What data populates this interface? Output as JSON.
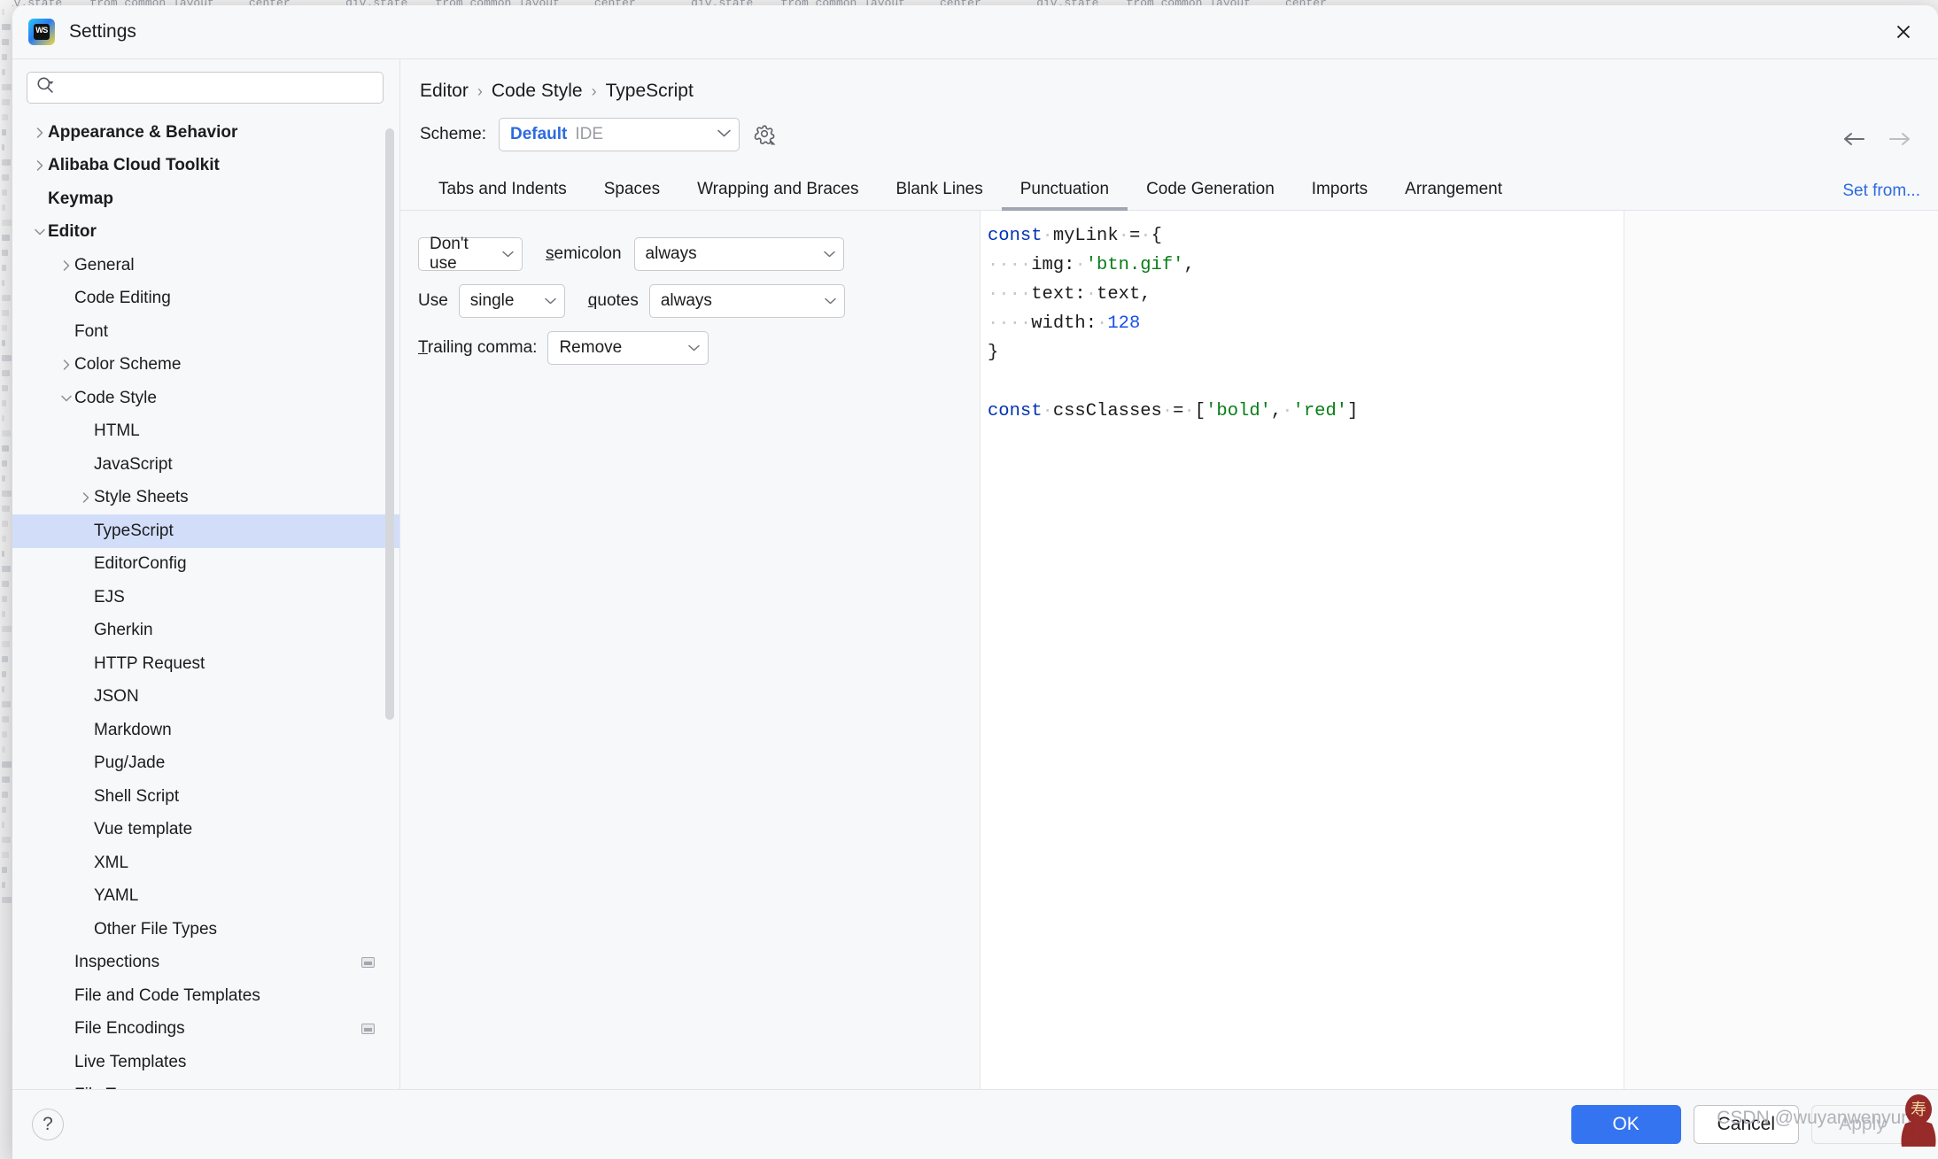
{
  "background": {
    "code_strip": "div.state    from common layout     center"
  },
  "window": {
    "title": "Settings",
    "app_icon": "webstorm-icon",
    "app_icon_text": "WS",
    "close_icon": "close-icon"
  },
  "sidebar": {
    "search": {
      "value": "",
      "placeholder": "",
      "icon": "search-icon"
    },
    "items": [
      {
        "label": "Appearance & Behavior",
        "depth": 0,
        "arrow": "right",
        "selected": false
      },
      {
        "label": "Alibaba Cloud Toolkit",
        "depth": 0,
        "arrow": "right",
        "selected": false
      },
      {
        "label": "Keymap",
        "depth": 0,
        "arrow": "none",
        "selected": false
      },
      {
        "label": "Editor",
        "depth": 0,
        "arrow": "down",
        "selected": false
      },
      {
        "label": "General",
        "depth": 1,
        "arrow": "right",
        "selected": false
      },
      {
        "label": "Code Editing",
        "depth": 1,
        "arrow": "none",
        "selected": false
      },
      {
        "label": "Font",
        "depth": 1,
        "arrow": "none",
        "selected": false
      },
      {
        "label": "Color Scheme",
        "depth": 1,
        "arrow": "right",
        "selected": false
      },
      {
        "label": "Code Style",
        "depth": 1,
        "arrow": "down",
        "selected": false
      },
      {
        "label": "HTML",
        "depth": 2,
        "arrow": "none",
        "selected": false
      },
      {
        "label": "JavaScript",
        "depth": 2,
        "arrow": "none",
        "selected": false
      },
      {
        "label": "Style Sheets",
        "depth": 2,
        "arrow": "right",
        "selected": false
      },
      {
        "label": "TypeScript",
        "depth": 2,
        "arrow": "none",
        "selected": true
      },
      {
        "label": "EditorConfig",
        "depth": 2,
        "arrow": "none",
        "selected": false
      },
      {
        "label": "EJS",
        "depth": 2,
        "arrow": "none",
        "selected": false
      },
      {
        "label": "Gherkin",
        "depth": 2,
        "arrow": "none",
        "selected": false
      },
      {
        "label": "HTTP Request",
        "depth": 2,
        "arrow": "none",
        "selected": false
      },
      {
        "label": "JSON",
        "depth": 2,
        "arrow": "none",
        "selected": false
      },
      {
        "label": "Markdown",
        "depth": 2,
        "arrow": "none",
        "selected": false
      },
      {
        "label": "Pug/Jade",
        "depth": 2,
        "arrow": "none",
        "selected": false
      },
      {
        "label": "Shell Script",
        "depth": 2,
        "arrow": "none",
        "selected": false
      },
      {
        "label": "Vue template",
        "depth": 2,
        "arrow": "none",
        "selected": false
      },
      {
        "label": "XML",
        "depth": 2,
        "arrow": "none",
        "selected": false
      },
      {
        "label": "YAML",
        "depth": 2,
        "arrow": "none",
        "selected": false
      },
      {
        "label": "Other File Types",
        "depth": 2,
        "arrow": "none",
        "selected": false
      },
      {
        "label": "Inspections",
        "depth": 1,
        "arrow": "none",
        "selected": false,
        "trailing_icon": "project-scope-icon"
      },
      {
        "label": "File and Code Templates",
        "depth": 1,
        "arrow": "none",
        "selected": false
      },
      {
        "label": "File Encodings",
        "depth": 1,
        "arrow": "none",
        "selected": false,
        "trailing_icon": "project-scope-icon"
      },
      {
        "label": "Live Templates",
        "depth": 1,
        "arrow": "none",
        "selected": false
      },
      {
        "label": "File Types",
        "depth": 1,
        "arrow": "none",
        "selected": false
      }
    ]
  },
  "main": {
    "breadcrumb": [
      "Editor",
      "Code Style",
      "TypeScript"
    ],
    "breadcrumb_separator": "›",
    "nav": {
      "back_icon": "arrow-left-icon",
      "forward_icon": "arrow-right-icon"
    },
    "set_from_link": "Set from...",
    "scheme": {
      "label": "Scheme:",
      "value": "Default",
      "value_suffix": "IDE",
      "gear_icon": "gear-icon",
      "chevron_icon": "chevron-down-icon"
    },
    "tabs": [
      {
        "label": "Tabs and Indents",
        "active": false
      },
      {
        "label": "Spaces",
        "active": false
      },
      {
        "label": "Wrapping and Braces",
        "active": false
      },
      {
        "label": "Blank Lines",
        "active": false
      },
      {
        "label": "Punctuation",
        "active": true
      },
      {
        "label": "Code Generation",
        "active": false
      },
      {
        "label": "Imports",
        "active": false
      },
      {
        "label": "Arrangement",
        "active": false
      }
    ],
    "punctuation": {
      "semicolon_use": "Don't use",
      "semicolon_label": "semicolon",
      "semicolon_label_mnemonic": "s",
      "semicolon_when": "always",
      "use_label": "Use",
      "quotes_style": "single",
      "quotes_label": "quotes",
      "quotes_label_mnemonic": "q",
      "quotes_when": "always",
      "trailing_comma_label": "Trailing comma:",
      "trailing_comma_label_mnemonic": "T",
      "trailing_comma_value": "Remove"
    },
    "preview": {
      "lines": [
        [
          {
            "t": "const",
            "c": "kw"
          },
          {
            "t": " ",
            "c": "ws"
          },
          {
            "t": "myLink",
            "c": ""
          },
          {
            "t": " ",
            "c": "ws"
          },
          {
            "t": "=",
            "c": ""
          },
          {
            "t": " ",
            "c": "ws"
          },
          {
            "t": "{",
            "c": ""
          }
        ],
        [
          {
            "t": "    ",
            "c": "ws"
          },
          {
            "t": "img:",
            "c": ""
          },
          {
            "t": " ",
            "c": "ws"
          },
          {
            "t": "'btn.gif'",
            "c": "str"
          },
          {
            "t": ",",
            "c": ""
          }
        ],
        [
          {
            "t": "    ",
            "c": "ws"
          },
          {
            "t": "text:",
            "c": ""
          },
          {
            "t": " ",
            "c": "ws"
          },
          {
            "t": "text,",
            "c": ""
          }
        ],
        [
          {
            "t": "    ",
            "c": "ws"
          },
          {
            "t": "width:",
            "c": ""
          },
          {
            "t": " ",
            "c": "ws"
          },
          {
            "t": "128",
            "c": "num"
          }
        ],
        [
          {
            "t": "}",
            "c": ""
          }
        ],
        [],
        [
          {
            "t": "const",
            "c": "kw"
          },
          {
            "t": " ",
            "c": "ws"
          },
          {
            "t": "cssClasses",
            "c": ""
          },
          {
            "t": " ",
            "c": "ws"
          },
          {
            "t": "=",
            "c": ""
          },
          {
            "t": " ",
            "c": "ws"
          },
          {
            "t": "[",
            "c": ""
          },
          {
            "t": "'bold'",
            "c": "str"
          },
          {
            "t": ",",
            "c": ""
          },
          {
            "t": " ",
            "c": "ws"
          },
          {
            "t": "'red'",
            "c": "str"
          },
          {
            "t": "]",
            "c": ""
          }
        ]
      ]
    }
  },
  "footer": {
    "help_icon": "help-icon",
    "help_label": "?",
    "ok_label": "OK",
    "cancel_label": "Cancel",
    "apply_label": "Apply"
  },
  "watermark": {
    "text": "CSDN @wuyanwenyun"
  },
  "colors": {
    "accent": "#3574f0",
    "link": "#2d6ae0",
    "selection": "#d2def9",
    "tab_underline": "#a1a6b3",
    "panel_bg": "#f7f8fa",
    "preview_bg": "#ffffff",
    "string": "#067d17",
    "keyword": "#0033b3",
    "number": "#1750eb"
  }
}
